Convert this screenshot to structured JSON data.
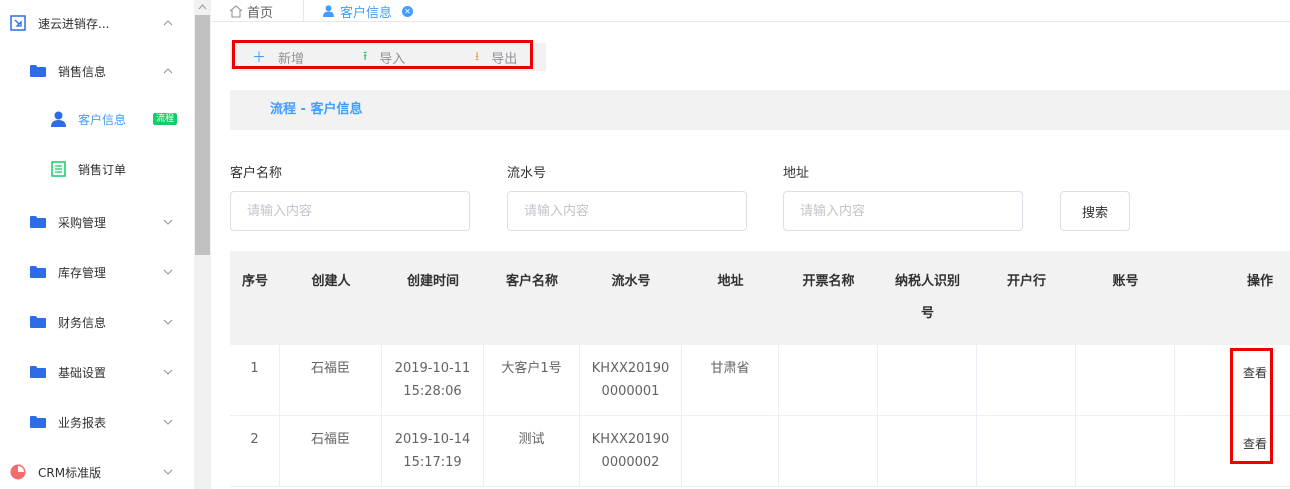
{
  "sidebar": {
    "app_title": "速云进销存...",
    "sales_group": "销售信息",
    "customer_info": "客户信息",
    "customer_badge": "流程",
    "sales_order": "销售订单",
    "purchase": "采购管理",
    "inventory": "库存管理",
    "finance": "财务信息",
    "settings": "基础设置",
    "reports": "业务报表",
    "crm": "CRM标准版"
  },
  "tabs": {
    "home": "首页",
    "active": "客户信息"
  },
  "toolbar": {
    "add": "新增",
    "import": "导入",
    "export": "导出"
  },
  "panel": {
    "title": "流程 - 客户信息"
  },
  "form": {
    "customer_name_label": "客户名称",
    "serial_label": "流水号",
    "address_label": "地址",
    "placeholder": "请输入内容",
    "search": "搜索"
  },
  "table": {
    "headers": {
      "index": "序号",
      "creator": "创建人",
      "created_at": "创建时间",
      "customer": "客户名称",
      "serial": "流水号",
      "address": "地址",
      "invoice": "开票名称",
      "taxid_line1": "纳税人识别",
      "taxid_line2": "号",
      "bank": "开户行",
      "account": "账号",
      "action": "操作"
    },
    "rows": [
      {
        "index": "1",
        "creator": "石福臣",
        "date": "2019-10-11",
        "time": "15:28:06",
        "customer": "大客户1号",
        "serial_1": "KHXX20190",
        "serial_2": "0000001",
        "address": "甘肃省",
        "action": "查看"
      },
      {
        "index": "2",
        "creator": "石福臣",
        "date": "2019-10-14",
        "time": "15:17:19",
        "customer": "测试",
        "serial_1": "KHXX20190",
        "serial_2": "0000002",
        "address": "",
        "action": "查看"
      }
    ]
  },
  "colors": {
    "accent": "#409eff",
    "folder": "#2e6be6",
    "highlight": "#ee0000",
    "badge": "#13ce66"
  }
}
